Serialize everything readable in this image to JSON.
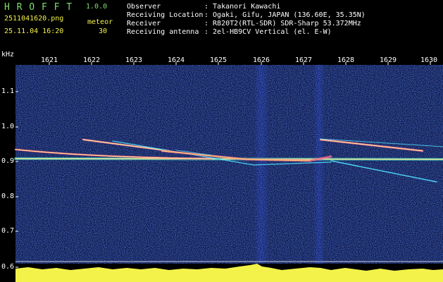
{
  "header": {
    "app_name": "H R O F F T",
    "version": "1.0.0",
    "filename": "2511041620.png",
    "datetime": "25.11.04 16:20",
    "meteor_label": "meteor",
    "meteor_count": "30"
  },
  "info": [
    {
      "label": "Observer",
      "value": ": Takanori Kawachi"
    },
    {
      "label": "Receiving Location",
      "value": ": Ogaki, Gifu, JAPAN (136.60E, 35.35N)"
    },
    {
      "label": "Receiver",
      "value": ": R820T2(RTL-SDR) SDR-Sharp 53.372MHz"
    },
    {
      "label": "Receiving antenna",
      "value": ": 2el-HB9CV Vertical (el. E-W)"
    }
  ],
  "axis": {
    "y_unit": "kHz",
    "y_ticks": [
      "1.1",
      "1.0",
      "0.9",
      "0.8",
      "0.7",
      "0.6"
    ],
    "x_ticks": [
      "1621",
      "1622",
      "1623",
      "1624",
      "1625",
      "1626",
      "1627",
      "1628",
      "1629",
      "1630"
    ]
  },
  "colors": {
    "background": "#000000",
    "spectrum_bg": "#0a1240",
    "title_green": "#7ee06a",
    "bar_yellow": "#f2f24a",
    "carrier": "#e8f080"
  }
}
